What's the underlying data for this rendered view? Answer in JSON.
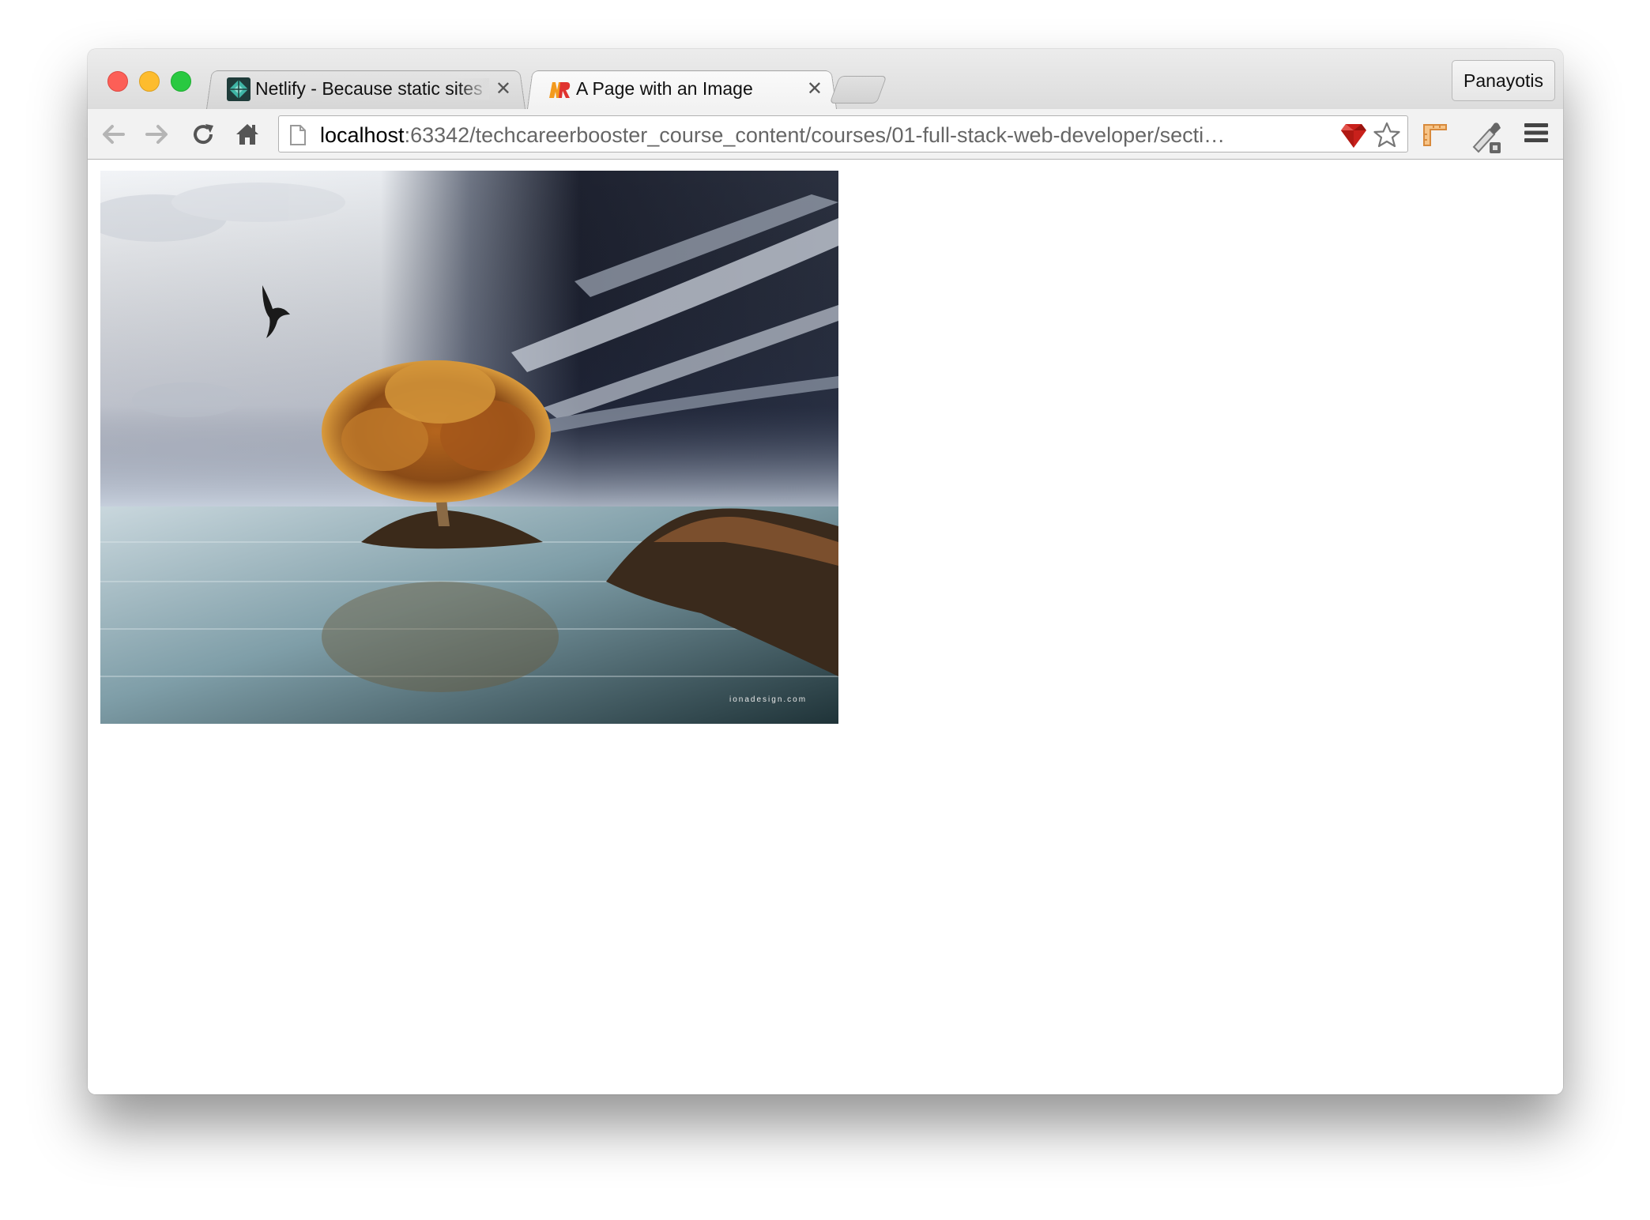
{
  "window": {
    "controls": [
      "close",
      "minimize",
      "zoom"
    ]
  },
  "tabs": [
    {
      "title": "Netlify - Because static sites",
      "active": false,
      "icon": "netlify-favicon-icon",
      "close": "✕"
    },
    {
      "title": "A Page with an Image",
      "active": true,
      "icon": "webstorm-favicon-icon",
      "close": "✕"
    }
  ],
  "profile": {
    "name": "Panayotis"
  },
  "toolbar": {
    "back_icon": "arrow-back-icon",
    "forward_icon": "arrow-forward-icon",
    "reload_icon": "reload-icon",
    "home_icon": "home-icon",
    "url_host": "localhost",
    "url_rest": ":63342/techcareerbooster_course_content/courses/01-full-stack-web-developer/secti…",
    "extension_icons": [
      "ruby-gem-icon",
      "bookmark-star-icon",
      "ruler-icon",
      "eyedropper-icon",
      "menu-icon"
    ]
  },
  "content": {
    "image": {
      "description_icon": "landscape-tree-island-photo",
      "watermark": "ionadesign.com"
    }
  },
  "colors": {
    "titlebar": "#e4e4e4",
    "toolbar": "#f2f2f2",
    "traffic_red": "#fc5f57",
    "traffic_yellow": "#fdbc2e",
    "traffic_green": "#29c941"
  }
}
